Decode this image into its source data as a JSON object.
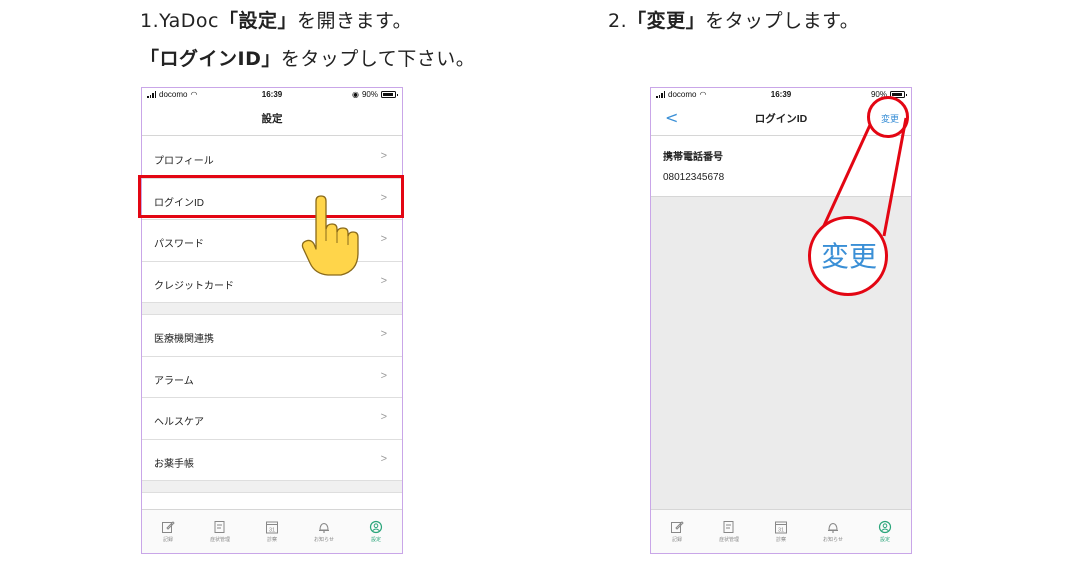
{
  "steps": {
    "step1_line1_pre": "1.YaDoc",
    "step1_line1_bold": "「設定」",
    "step1_line1_post": "を開きます。",
    "step1_line2_bold": "「ログインID」",
    "step1_line2_post": "をタップして下さい。",
    "step2_pre": "2.",
    "step2_bold": "「変更」",
    "step2_post": "をタップします。"
  },
  "status_bar": {
    "carrier": "docomo",
    "time": "16:39",
    "battery": "90%"
  },
  "screen1": {
    "title": "設定",
    "chevron": ">",
    "group1": [
      "プロフィール",
      "ログインID",
      "パスワード",
      "クレジットカード"
    ],
    "group2": [
      "医療機関連携",
      "アラーム",
      "ヘルスケア",
      "お薬手帳"
    ],
    "partial_row": "..."
  },
  "screen2": {
    "back": "<",
    "title": "ログインID",
    "action": "変更",
    "field_label": "携帯電話番号",
    "field_value": "08012345678"
  },
  "tabbar": {
    "tabs": [
      {
        "label": "記録",
        "icon": "edit-icon"
      },
      {
        "label": "症状管理",
        "icon": "note-icon"
      },
      {
        "label": "診察",
        "icon": "calendar-icon",
        "day": "31"
      },
      {
        "label": "お知らせ",
        "icon": "bell-icon"
      },
      {
        "label": "設定",
        "icon": "user-circle-icon",
        "active": true
      }
    ]
  },
  "zoom": {
    "text": "変更"
  },
  "colors": {
    "accent": "#3a8fd6",
    "highlight": "#e30613",
    "active_tab": "#2aa57a",
    "frame": "#c9a6e8"
  }
}
